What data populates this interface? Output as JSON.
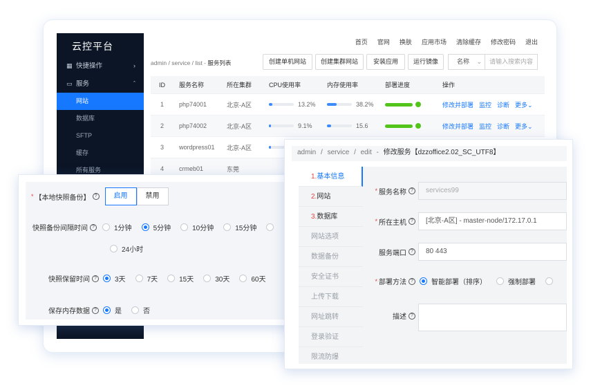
{
  "sidebar": {
    "title": "云控平台",
    "groups": [
      {
        "label": "快捷操作",
        "icon": "grid-icon",
        "chevron": "›"
      },
      {
        "label": "服务",
        "icon": "server-icon",
        "chevron": "ˆ"
      }
    ],
    "subitems": [
      "网站",
      "数据库",
      "SFTP",
      "缓存",
      "所有服务"
    ]
  },
  "topnav": [
    "首页",
    "官网",
    "换肤",
    "应用市场",
    "清除缓存",
    "修改密码",
    "退出"
  ],
  "toolbar": {
    "crumb": {
      "a": "admin",
      "b": "service",
      "c": "list",
      "d": "服务列表",
      "sep": "/",
      "sep2": "-"
    },
    "buttons": [
      "创建单机网站",
      "创建集群网站",
      "安装应用",
      "运行镜像"
    ],
    "select": "名称",
    "select_arrow": "⌄",
    "search_placeholder": "请输入搜索内容"
  },
  "table": {
    "headers": [
      "ID",
      "服务名称",
      "所在集群",
      "CPU使用率",
      "内存使用率",
      "部署进度",
      "操作"
    ],
    "rows": [
      {
        "id": "1",
        "name": "php74001",
        "cluster": "北京-A区",
        "cpu": "13.2%",
        "cpu_v": 13.2,
        "mem": "38.2%",
        "mem_v": 38.2,
        "ops": [
          "修改并部署",
          "监控",
          "诊断",
          "更多⌄"
        ]
      },
      {
        "id": "2",
        "name": "php74002",
        "cluster": "北京-A区",
        "cpu": "9.1%",
        "cpu_v": 9.1,
        "mem": "15.6",
        "mem_v": 15.6,
        "ops": [
          "修改并部署",
          "监控",
          "诊断",
          "更多⌄"
        ]
      },
      {
        "id": "3",
        "name": "wordpress01",
        "cluster": "北京-A区",
        "cpu": "",
        "cpu_v": 8,
        "mem": "",
        "mem_v": 0,
        "ops": []
      },
      {
        "id": "4",
        "name": "crmeb01",
        "cluster": "东莞",
        "cpu": "",
        "cpu_v": 0,
        "mem": "",
        "mem_v": 0,
        "ops": []
      }
    ]
  },
  "backup_panel": {
    "title": "【本地快照备份】",
    "help": "?",
    "toggle": [
      "启用",
      "禁用"
    ],
    "interval_label": "快照备份间隔时间",
    "interval_options": [
      "1分钟",
      "5分钟",
      "10分钟",
      "15分钟",
      "24小时"
    ],
    "interval_selected": 1,
    "retain_label": "快照保留时间",
    "retain_options": [
      "3天",
      "7天",
      "15天",
      "30天",
      "60天"
    ],
    "retain_selected": 0,
    "memory_label": "保存内存数据",
    "memory_options": [
      "是",
      "否"
    ],
    "memory_selected": 0
  },
  "edit_panel": {
    "crumb": {
      "a": "admin",
      "b": "service",
      "c": "edit",
      "d": "修改服务【dzzoffice2.02_SC_UTF8】",
      "sep": "/",
      "sep2": "-"
    },
    "tabs": [
      {
        "num": "1.",
        "label": "基本信息"
      },
      {
        "num": "2.",
        "label": "网站"
      },
      {
        "num": "3.",
        "label": "数据库"
      },
      {
        "num": "",
        "label": "网站选项"
      },
      {
        "num": "",
        "label": "数据备份"
      },
      {
        "num": "",
        "label": "安全证书"
      },
      {
        "num": "",
        "label": "上传下载"
      },
      {
        "num": "",
        "label": "网址跳转"
      },
      {
        "num": "",
        "label": "登录验证"
      },
      {
        "num": "",
        "label": "限流防爆"
      }
    ],
    "fields": {
      "name_label": "服务名称",
      "name_value": "services99",
      "host_label": "所在主机",
      "host_value": "[北京-A区] - master-node/172.17.0.1",
      "port_label": "服务端口",
      "port_value": "80 443",
      "deploy_label": "部署方法",
      "deploy_options": [
        "智能部署（排序）",
        "强制部署"
      ],
      "deploy_selected": 0,
      "desc_label": "描述"
    }
  },
  "colors": {
    "primary": "#1677ff",
    "sidebar": "#0b1526",
    "success": "#52c41a",
    "required": "#e54545"
  }
}
